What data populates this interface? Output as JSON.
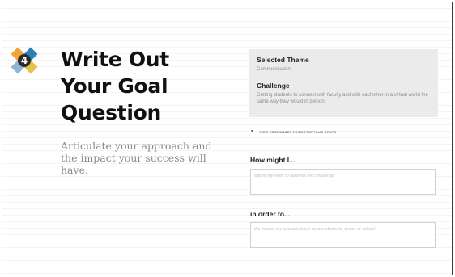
{
  "step": {
    "number": "4",
    "badge_colors": [
      "#f2a23a",
      "#2f7fb8",
      "#e7c24a",
      "#8fb4d6"
    ]
  },
  "title": {
    "lines": [
      "Write Out",
      "Your Goal",
      "Question"
    ]
  },
  "subtitle": "Articulate your approach and the impact your success will have.",
  "theme_panel": {
    "theme_label": "Selected Theme",
    "theme_value": "Communication",
    "challenge_label": "Challenge",
    "challenge_value": "Getting students to connect with faculty and with eachother in a virtual world the same way they would in person."
  },
  "toggle": {
    "label": "VIEW RESPONSES FROM PREVIOUS STEPS",
    "icon": "triangle-down-icon"
  },
  "how_might": {
    "label": "How might I...",
    "placeholder": "adjust my work to address this challenge"
  },
  "in_order_to": {
    "label": "in order to...",
    "placeholder": "the impact my success have on our students, team, or school"
  }
}
